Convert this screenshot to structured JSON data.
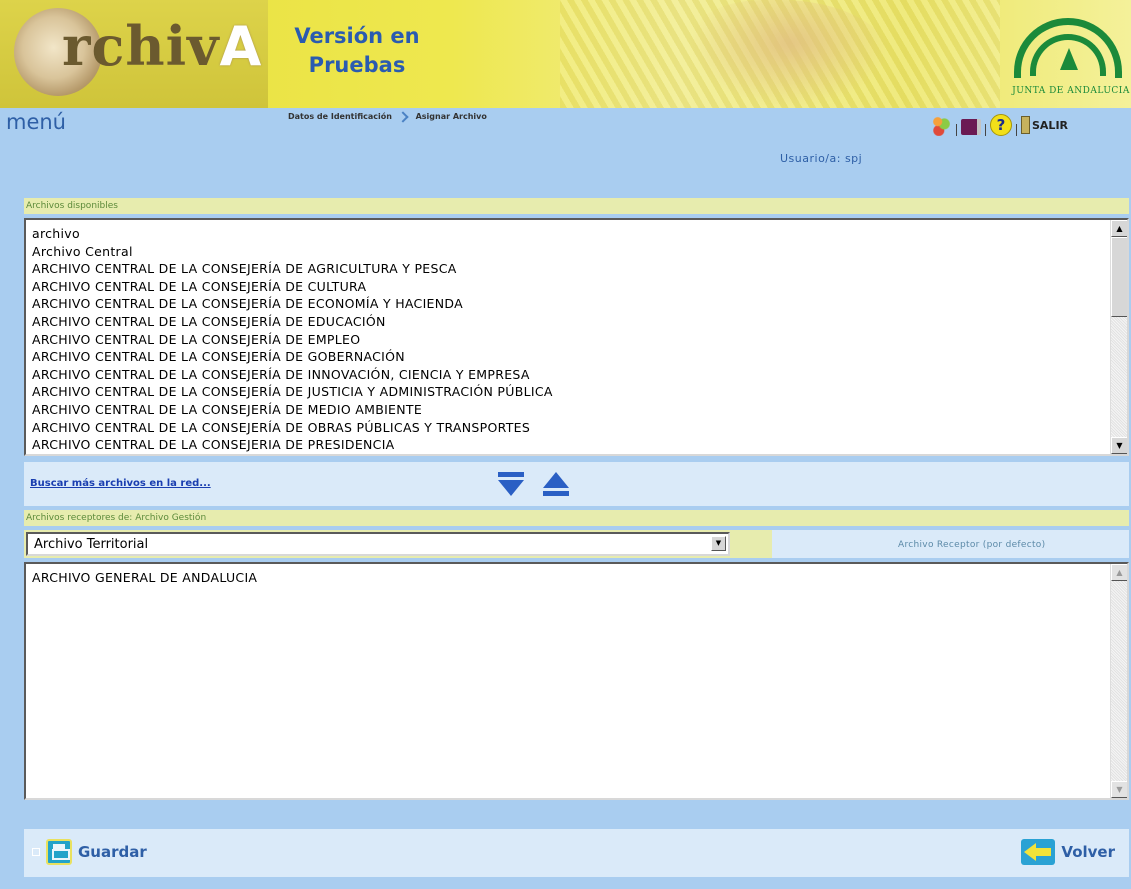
{
  "header": {
    "logo_prefix": "@",
    "logo_text": "rchiv",
    "logo_suffix": "A",
    "version_line1": "Versión en",
    "version_line2": "Pruebas",
    "junta_label": "JUNTA DE ANDALUCIA"
  },
  "nav": {
    "menu_label": "menú",
    "breadcrumb": [
      "Datos de Identificación",
      "Asignar Archivo"
    ],
    "salir_label": "SALIR",
    "help_glyph": "?"
  },
  "user": {
    "label": "Usuario/a: spj"
  },
  "available": {
    "label": "Archivos disponibles",
    "items": [
      "archivo",
      "Archivo Central",
      "ARCHIVO CENTRAL DE LA CONSEJERÍA DE AGRICULTURA Y PESCA",
      "ARCHIVO CENTRAL DE LA CONSEJERÍA DE CULTURA",
      "ARCHIVO CENTRAL DE LA CONSEJERÍA DE ECONOMÍA Y HACIENDA",
      "ARCHIVO CENTRAL DE LA CONSEJERÍA DE EDUCACIÓN",
      "ARCHIVO CENTRAL DE LA CONSEJERÍA DE EMPLEO",
      "ARCHIVO CENTRAL DE LA CONSEJERÍA DE GOBERNACIÓN",
      "ARCHIVO CENTRAL DE LA CONSEJERÍA DE INNOVACIÓN, CIENCIA Y EMPRESA",
      "ARCHIVO CENTRAL DE LA CONSEJERÍA DE JUSTICIA Y ADMINISTRACIÓN PÚBLICA",
      "ARCHIVO CENTRAL DE LA CONSEJERÍA DE MEDIO AMBIENTE",
      "ARCHIVO CENTRAL DE LA CONSEJERÍA DE OBRAS PÚBLICAS Y TRANSPORTES",
      "ARCHIVO CENTRAL DE LA CONSEJERIA DE PRESIDENCIA"
    ]
  },
  "actions": {
    "more_link": "Buscar más archivos en la red..."
  },
  "receptors": {
    "label": "Archivos receptores de: Archivo Gestión",
    "selected_type": "Archivo Territorial",
    "default_label": "Archivo Receptor (por defecto)",
    "items": [
      "ARCHIVO GENERAL DE ANDALUCIA"
    ]
  },
  "footer": {
    "save_label": "Guardar",
    "back_label": "Volver"
  }
}
